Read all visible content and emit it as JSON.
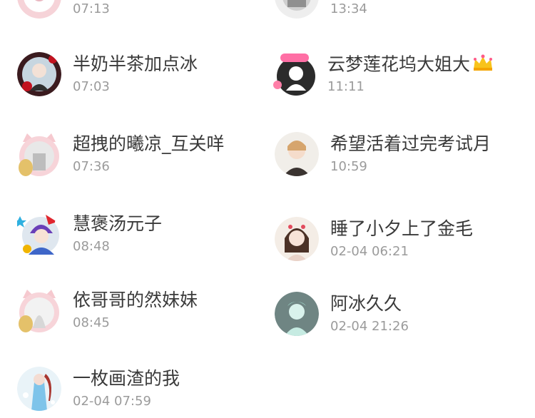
{
  "contacts": [
    {
      "name": "",
      "time": "07:13"
    },
    {
      "name": "",
      "time": "13:34"
    },
    {
      "name": "半奶半茶加点冰",
      "time": "07:03"
    },
    {
      "name": "云梦莲花坞大姐大",
      "time": "11:11",
      "badge": "crown-badge"
    },
    {
      "name": "超拽的曦凉_互关咩",
      "time": "07:36"
    },
    {
      "name": "希望活着过完考试月",
      "time": "10:59"
    },
    {
      "name": "慧褒汤元子",
      "time": "08:48"
    },
    {
      "name": "睡了小夕上了金毛",
      "time": "02-04 06:21"
    },
    {
      "name": "依哥哥的然妹妹",
      "time": "08:45"
    },
    {
      "name": "阿冰久久",
      "time": "02-04 21:26"
    },
    {
      "name": "一枚画渣的我",
      "time": "02-04 07:59"
    }
  ],
  "colors": {
    "name": "#3a3a3a",
    "time": "#9b9b9b",
    "background": "#ffffff"
  }
}
